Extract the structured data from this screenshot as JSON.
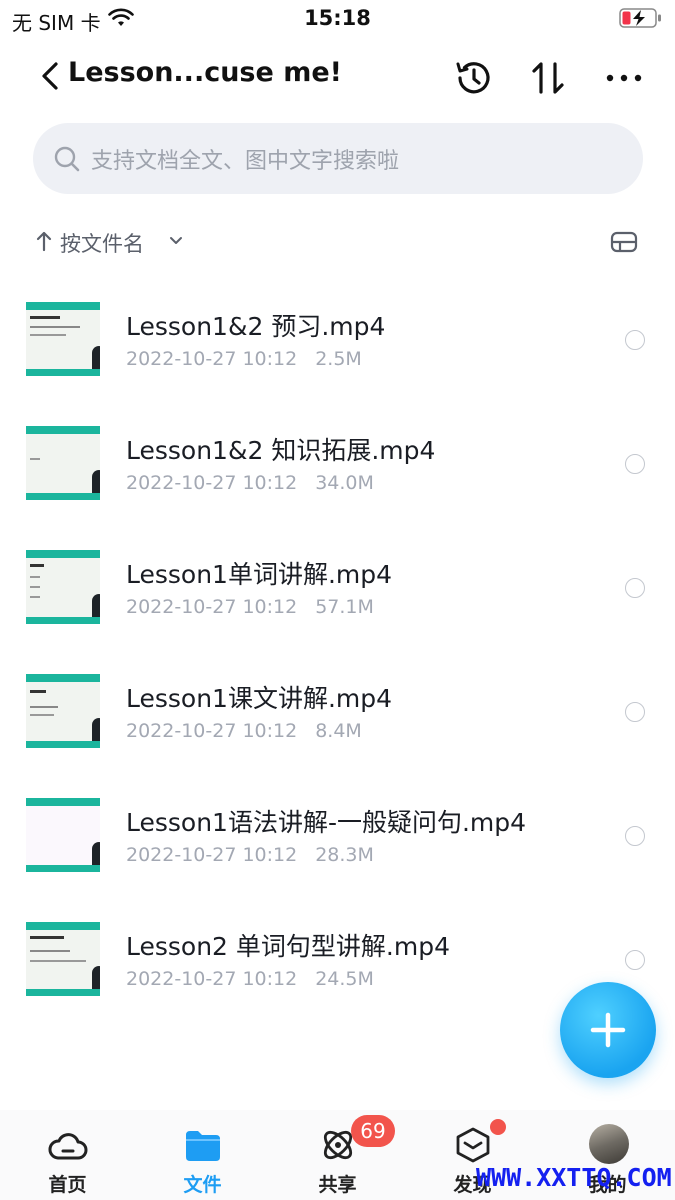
{
  "status_bar": {
    "carrier": "无 SIM 卡",
    "time": "15:18",
    "wifi_icon": "wifi-icon",
    "battery_icon": "battery-charging-icon"
  },
  "header": {
    "title": "Lesson...cuse me!",
    "icons": [
      "back-icon",
      "history-icon",
      "sort-icon",
      "more-icon"
    ]
  },
  "search": {
    "placeholder": "支持文档全文、图中文字搜索啦"
  },
  "sort": {
    "label": "按文件名",
    "direction": "ascending"
  },
  "files": [
    {
      "name": "Lesson1&2 预习.mp4",
      "date": "2022-10-27 10:12",
      "size": "2.5M"
    },
    {
      "name": "Lesson1&2 知识拓展.mp4",
      "date": "2022-10-27 10:12",
      "size": "34.0M"
    },
    {
      "name": "Lesson1单词讲解.mp4",
      "date": "2022-10-27 10:12",
      "size": "57.1M"
    },
    {
      "name": "Lesson1课文讲解.mp4",
      "date": "2022-10-27 10:12",
      "size": "8.4M"
    },
    {
      "name": "Lesson1语法讲解-一般疑问句.mp4",
      "date": "2022-10-27 10:12",
      "size": "28.3M"
    },
    {
      "name": "Lesson2 单词句型讲解.mp4",
      "date": "2022-10-27 10:12",
      "size": "24.5M"
    }
  ],
  "tabs": [
    {
      "label": "首页",
      "icon": "cloud-icon"
    },
    {
      "label": "文件",
      "icon": "folder-icon",
      "active": true
    },
    {
      "label": "共享",
      "icon": "share-orbit-icon",
      "badge": "69"
    },
    {
      "label": "发现",
      "icon": "discover-cube-icon",
      "dot": true
    },
    {
      "label": "我的",
      "icon": "avatar"
    }
  ],
  "watermark": "WWW.XXTTQ.COM",
  "colors": {
    "accent": "#1e9df3",
    "badge": "#f2544c",
    "thumb_green": "#1bb59d"
  }
}
